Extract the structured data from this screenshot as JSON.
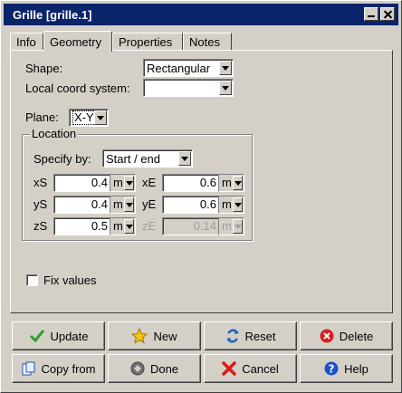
{
  "window": {
    "title": "Grille [grille.1]"
  },
  "tabs": [
    {
      "label": "Info",
      "active": false
    },
    {
      "label": "Geometry",
      "active": true
    },
    {
      "label": "Properties",
      "active": false
    },
    {
      "label": "Notes",
      "active": false
    }
  ],
  "geometry": {
    "shape_label": "Shape:",
    "shape_value": "Rectangular",
    "lcs_label": "Local coord system:",
    "lcs_value": "",
    "plane_label": "Plane:",
    "plane_value": "X-Y",
    "location": {
      "legend": "Location",
      "specify_label": "Specify by:",
      "specify_value": "Start / end",
      "xs": {
        "label": "xS",
        "value": "0.4",
        "unit": "m"
      },
      "ys": {
        "label": "yS",
        "value": "0.4",
        "unit": "m"
      },
      "zs": {
        "label": "zS",
        "value": "0.5",
        "unit": "m"
      },
      "xe": {
        "label": "xE",
        "value": "0.6",
        "unit": "m"
      },
      "ye": {
        "label": "yE",
        "value": "0.6",
        "unit": "m"
      },
      "ze": {
        "label": "zE",
        "value": "0.14",
        "unit": "m",
        "disabled": true
      }
    },
    "fix_values_label": "Fix values",
    "fix_values_checked": false
  },
  "buttons": {
    "update": "Update",
    "new": "New",
    "reset": "Reset",
    "delete": "Delete",
    "copy_from": "Copy from",
    "done": "Done",
    "cancel": "Cancel",
    "help": "Help"
  },
  "colors": {
    "titlebar": "#0a246a",
    "face": "#d4d0c8",
    "check_green": "#2e9e2e",
    "delete_red": "#d42020",
    "cancel_red": "#e01818",
    "help_blue": "#1e50c8"
  }
}
